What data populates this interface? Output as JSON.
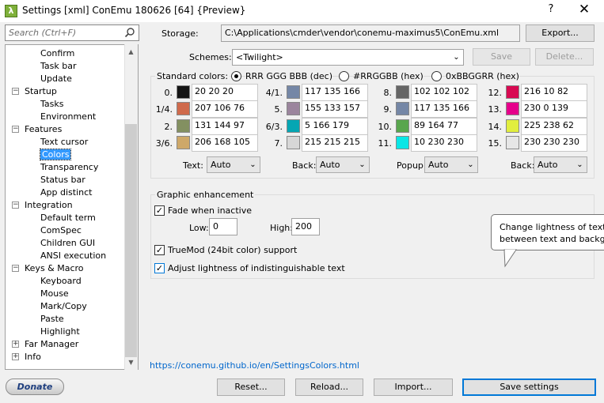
{
  "window": {
    "title": "Settings [xml] ConEmu 180626 [64] {Preview}",
    "help_label": "?",
    "close_label": "✕",
    "app_icon_label": "λ"
  },
  "sidebar": {
    "search_placeholder": "Search (Ctrl+F)",
    "tree": [
      {
        "label": "Confirm",
        "level": 2
      },
      {
        "label": "Task bar",
        "level": 2
      },
      {
        "label": "Update",
        "level": 2
      },
      {
        "label": "Startup",
        "level": 1,
        "expander": "−"
      },
      {
        "label": "Tasks",
        "level": 2
      },
      {
        "label": "Environment",
        "level": 2
      },
      {
        "label": "Features",
        "level": 1,
        "expander": "−"
      },
      {
        "label": "Text cursor",
        "level": 2
      },
      {
        "label": "Colors",
        "level": 2,
        "selected": true
      },
      {
        "label": "Transparency",
        "level": 2
      },
      {
        "label": "Status bar",
        "level": 2
      },
      {
        "label": "App distinct",
        "level": 2
      },
      {
        "label": "Integration",
        "level": 1,
        "expander": "−"
      },
      {
        "label": "Default term",
        "level": 2
      },
      {
        "label": "ComSpec",
        "level": 2
      },
      {
        "label": "Children GUI",
        "level": 2
      },
      {
        "label": "ANSI execution",
        "level": 2
      },
      {
        "label": "Keys & Macro",
        "level": 1,
        "expander": "−"
      },
      {
        "label": "Keyboard",
        "level": 2
      },
      {
        "label": "Mouse",
        "level": 2
      },
      {
        "label": "Mark/Copy",
        "level": 2
      },
      {
        "label": "Paste",
        "level": 2
      },
      {
        "label": "Highlight",
        "level": 2
      },
      {
        "label": "Far Manager",
        "level": 1,
        "expander": "+"
      },
      {
        "label": "Info",
        "level": 1,
        "expander": "+"
      }
    ],
    "donate_label": "Donate"
  },
  "storage": {
    "label": "Storage:",
    "path": "C:\\Applications\\cmder\\vendor\\conemu-maximus5\\ConEmu.xml",
    "export_label": "Export..."
  },
  "schemes": {
    "label": "Schemes:",
    "value": "<Twilight>",
    "save_label": "Save",
    "delete_label": "Delete..."
  },
  "standard_colors": {
    "label": "Standard colors:",
    "formats": [
      {
        "label": "RRR GGG BBB (dec)",
        "selected": true
      },
      {
        "label": "#RRGGBB (hex)",
        "selected": false
      },
      {
        "label": "0xBBGGRR (hex)",
        "selected": false
      }
    ],
    "palette": [
      {
        "index": "0.",
        "color": "#141414",
        "value": "20 20 20"
      },
      {
        "index": "1/4.",
        "color": "#cf6a4c",
        "value": "207 106 76"
      },
      {
        "index": "2.",
        "color": "#839061",
        "value": "131 144 97"
      },
      {
        "index": "3/6.",
        "color": "#cea869",
        "value": "206 168 105"
      },
      {
        "index": "4/1.",
        "color": "#7587a6",
        "value": "117 135 166"
      },
      {
        "index": "5.",
        "color": "#9b859d",
        "value": "155 133 157"
      },
      {
        "index": "6/3.",
        "color": "#05a6b3",
        "value": "5 166 179"
      },
      {
        "index": "7.",
        "color": "#d7d7d7",
        "value": "215 215 215"
      },
      {
        "index": "8.",
        "color": "#666666",
        "value": "102 102 102"
      },
      {
        "index": "9.",
        "color": "#7587a6",
        "value": "117 135 166"
      },
      {
        "index": "10.",
        "color": "#59a64d",
        "value": "89 164 77"
      },
      {
        "index": "11.",
        "color": "#0ae6e6",
        "value": "10 230 230"
      },
      {
        "index": "12.",
        "color": "#d80a52",
        "value": "216 10 82"
      },
      {
        "index": "13.",
        "color": "#e6008b",
        "value": "230 0 139"
      },
      {
        "index": "14.",
        "color": "#e1ee3e",
        "value": "225 238 62"
      },
      {
        "index": "15.",
        "color": "#e6e6e6",
        "value": "230 230 230"
      }
    ],
    "selectors": [
      {
        "label": "Text:",
        "value": "Auto"
      },
      {
        "label": "Back:",
        "value": "Auto"
      },
      {
        "label": "Popup:",
        "value": "Auto"
      },
      {
        "label": "Back:",
        "value": "Auto"
      }
    ]
  },
  "graphic": {
    "title": "Graphic enhancement",
    "fade_label": "Fade when inactive",
    "fade_checked": true,
    "low_label": "Low:",
    "low_value": "0",
    "high_label": "High:",
    "high_value": "200",
    "truemod_label": "TrueMod (24bit color) support",
    "truemod_checked": true,
    "adjust_label": "Adjust lightness of indistinguishable text",
    "adjust_checked": true
  },
  "tooltip": {
    "line1": "Change lightness of text i",
    "line2": "between text and backgro"
  },
  "footer": {
    "link": "https://conemu.github.io/en/SettingsColors.html",
    "reset_label": "Reset...",
    "reload_label": "Reload...",
    "import_label": "Import...",
    "save_settings_label": "Save settings"
  }
}
